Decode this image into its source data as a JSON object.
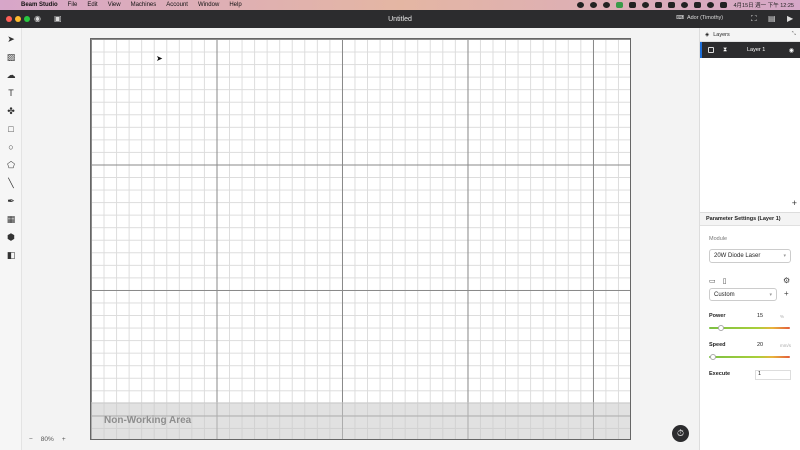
{
  "menubar": {
    "apple": "",
    "app_name": "Beam Studio",
    "items": [
      "File",
      "Edit",
      "View",
      "Machines",
      "Account",
      "Window",
      "Help"
    ],
    "clock": "4月15日 週一 下午 12:25"
  },
  "titlebar": {
    "title": "Untitled",
    "device": "Ador (Timothy)"
  },
  "tools": [
    "select-arrow-icon",
    "image-icon",
    "cloud-icon",
    "text-icon",
    "elements-icon",
    "rectangle-icon",
    "ellipse-icon",
    "polygon-icon",
    "line-icon",
    "pen-icon",
    "qrcode-icon",
    "box-icon",
    "dmkt-icon"
  ],
  "canvas": {
    "non_working_label": "Non-Working Area",
    "zoom_minus": "−",
    "zoom_value": "80%",
    "zoom_plus": "+"
  },
  "layers": {
    "header": "Layers",
    "items": [
      {
        "name": "Layer 1",
        "selected": true
      }
    ],
    "add_symbol": "+"
  },
  "params": {
    "header": "Parameter Settings (Layer 1)",
    "module_label": "Module",
    "module_value": "20W Diode Laser",
    "preset_value": "Custom",
    "power_label": "Power",
    "power_value": "15",
    "power_unit": "%",
    "power_fraction": 0.15,
    "speed_label": "Speed",
    "speed_value": "20",
    "speed_unit": "mm/s",
    "speed_fraction": 0.05,
    "execute_label": "Execute",
    "execute_value": "1"
  },
  "colors": {
    "accent": "#1e6fd9",
    "dark": "#2c2c2e",
    "slider_green": "#7cc043",
    "slider_red": "#e25d3c"
  }
}
